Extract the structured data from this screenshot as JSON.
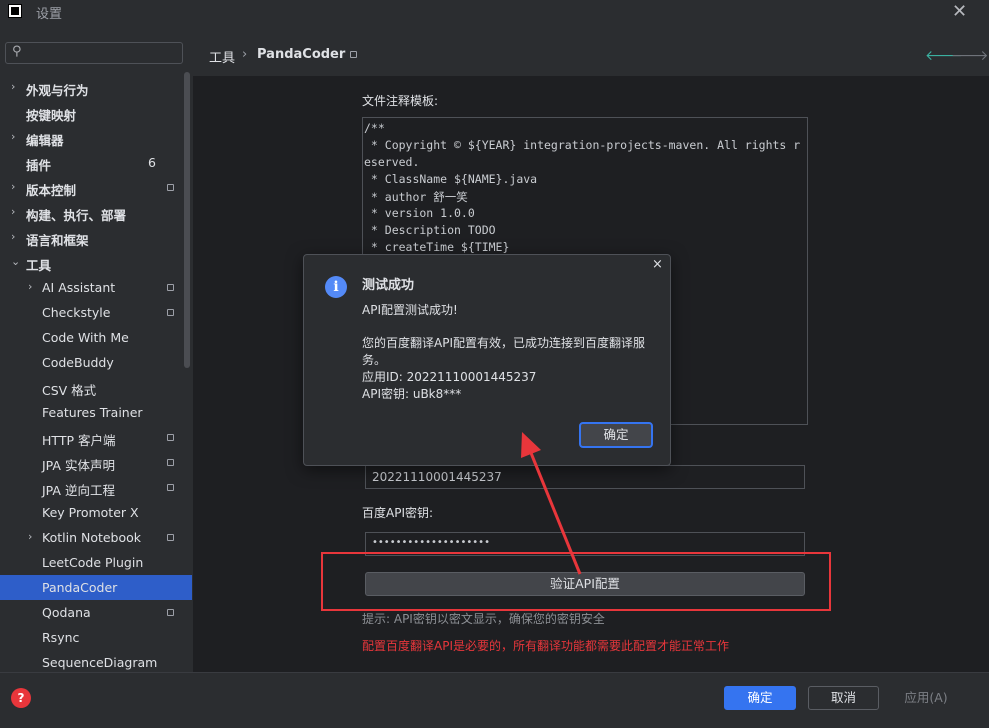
{
  "window": {
    "title": "设置"
  },
  "search": {
    "placeholder": ""
  },
  "sidebar": {
    "items": [
      {
        "label": "外观与行为",
        "chevron": "›",
        "bold": true
      },
      {
        "label": "按键映射",
        "bold": true
      },
      {
        "label": "编辑器",
        "chevron": "›",
        "bold": true
      },
      {
        "label": "插件",
        "bold": true,
        "count": "6"
      },
      {
        "label": "版本控制",
        "chevron": "›",
        "bold": true
      },
      {
        "label": "构建、执行、部署",
        "chevron": "›",
        "bold": true
      },
      {
        "label": "语言和框架",
        "chevron": "›",
        "bold": true
      },
      {
        "label": "工具",
        "chevron": "⌄",
        "bold": true
      },
      {
        "label": "AI Assistant",
        "chevron": "›"
      },
      {
        "label": "Checkstyle"
      },
      {
        "label": "Code With Me"
      },
      {
        "label": "CodeBuddy"
      },
      {
        "label": "CSV 格式"
      },
      {
        "label": "Features Trainer"
      },
      {
        "label": "HTTP 客户端"
      },
      {
        "label": "JPA 实体声明"
      },
      {
        "label": "JPA 逆向工程"
      },
      {
        "label": "Key Promoter X"
      },
      {
        "label": "Kotlin Notebook",
        "chevron": "›"
      },
      {
        "label": "LeetCode Plugin"
      },
      {
        "label": "PandaCoder"
      },
      {
        "label": "Qodana"
      },
      {
        "label": "Rsync"
      },
      {
        "label": "SequenceDiagram"
      }
    ]
  },
  "breadcrumb": {
    "root": "工具",
    "sep": "›",
    "current": "PandaCoder"
  },
  "nav": {
    "back": "🡐",
    "forward": "🡒"
  },
  "form": {
    "template_label": "文件注释模板:",
    "template_lines": [
      "/**",
      " * Copyright © ${YEAR} integration-projects-maven. All rights r",
      "eserved.",
      " * ClassName ${NAME}.java",
      " * author 舒一笑",
      " * version 1.0.0",
      " * Description TODO",
      " * createTime ${TIME}"
    ],
    "app_id_value": "20221110001445237",
    "secret_label": "百度API密钥:",
    "secret_value": "••••••••••••••••••••",
    "verify_button": "验证API配置",
    "hint": "提示: API密钥以密文显示，确保您的密钥安全",
    "warning": "配置百度翻译API是必要的，所有翻译功能都需要此配置才能正常工作"
  },
  "dialog": {
    "title": "测试成功",
    "line1": "API配置测试成功!",
    "line2": "您的百度翻译API配置有效，已成功连接到百度翻译服",
    "line3": "务。",
    "line4": "应用ID: 20221110001445237",
    "line5": "API密钥: uBk8***",
    "ok": "确定",
    "close": "×"
  },
  "footer": {
    "ok": "确定",
    "cancel": "取消",
    "apply": "应用(A)",
    "help": "?"
  },
  "colors": {
    "accent": "#3574f0",
    "selection": "#2e5ec9",
    "warning": "#e8363b"
  }
}
